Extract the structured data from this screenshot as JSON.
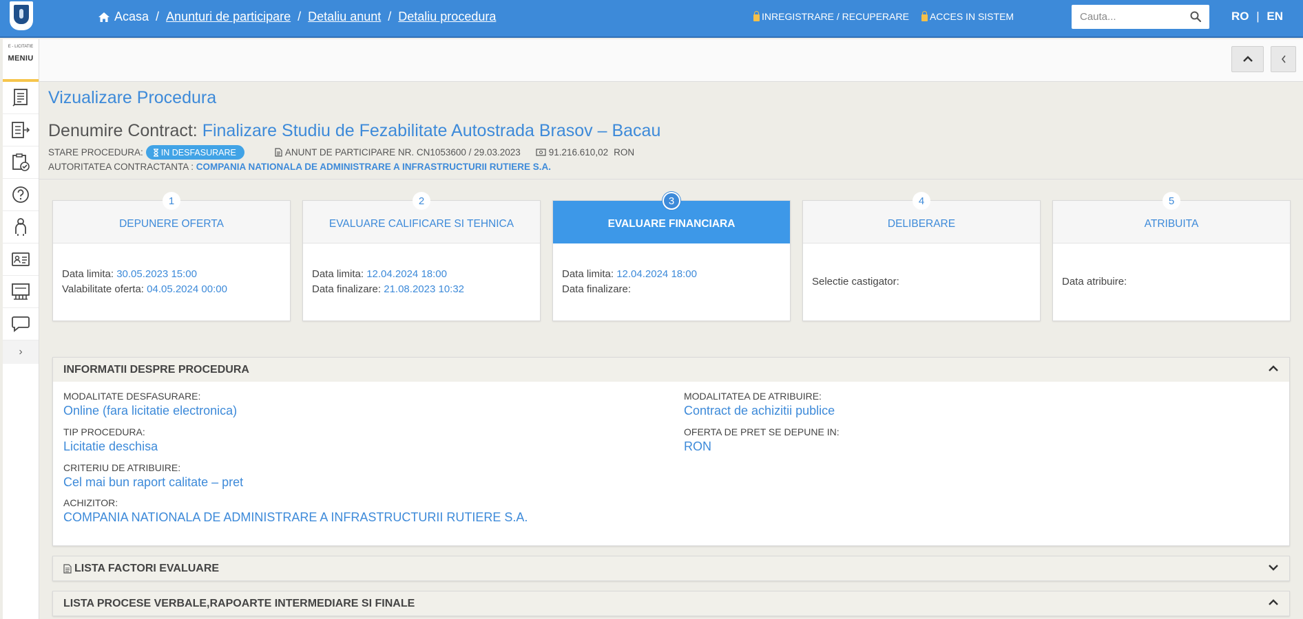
{
  "topbar": {
    "breadcrumbs": [
      "Acasa",
      "Anunturi de participare",
      "Detaliu anunt",
      "Detaliu procedura"
    ],
    "links": {
      "register": "INREGISTRARE / RECUPERARE",
      "login": "ACCES IN SISTEM"
    },
    "search_placeholder": "Cauta...",
    "lang": {
      "ro": "RO",
      "sep": "|",
      "en": "EN"
    }
  },
  "sidebar": {
    "brand_small": "E - LICITATIE",
    "menu_label": "MENIU",
    "items": [
      "document-icon",
      "list-arrow-icon",
      "clipboard-check-icon",
      "help-icon",
      "user-icon",
      "id-card-icon",
      "chart-icon",
      "chat-icon"
    ],
    "toggle": "›"
  },
  "header": {
    "title": "Vizualizare Procedura",
    "contract_label": "Denumire Contract:",
    "contract_name": "Finalizare Studiu de Fezabilitate Autostrada Brasov – Bacau",
    "status_label": "STARE PROCEDURA:",
    "status_value": "IN DESFASURARE",
    "notice": "ANUNT DE PARTICIPARE NR. CN1053600 / 29.03.2023",
    "value_amount": "91.216.610,02",
    "value_currency": "RON",
    "authority_label": "AUTORITATEA CONTRACTANTA :",
    "authority_value": "COMPANIA NATIONALA DE ADMINISTRARE A INFRASTRUCTURII RUTIERE S.A."
  },
  "steps": [
    {
      "num": "1",
      "title": "DEPUNERE OFERTA",
      "l1": "Data limita:",
      "v1": "30.05.2023 15:00",
      "l2": "Valabilitate oferta:",
      "v2": "04.05.2024 00:00"
    },
    {
      "num": "2",
      "title": "EVALUARE CALIFICARE SI TEHNICA",
      "l1": "Data limita:",
      "v1": "12.04.2024 18:00",
      "l2": "Data finalizare:",
      "v2": "21.08.2023 10:32"
    },
    {
      "num": "3",
      "title": "EVALUARE FINANCIARA",
      "l1": "Data limita:",
      "v1": "12.04.2024 18:00",
      "l2": "Data finalizare:",
      "v2": ""
    },
    {
      "num": "4",
      "title": "DELIBERARE",
      "l1": "Selectie castigator:"
    },
    {
      "num": "5",
      "title": "ATRIBUITA",
      "l1": "Data atribuire:"
    }
  ],
  "info_panel": {
    "title": "INFORMATII DESPRE PROCEDURA",
    "fields": {
      "mod_desf_label": "MODALITATE DESFASURARE:",
      "mod_desf_value": "Online (fara licitatie electronica)",
      "tip_label": "TIP PROCEDURA:",
      "tip_value": "Licitatie deschisa",
      "criteriu_label": "CRITERIU DE ATRIBUIRE:",
      "criteriu_value": "Cel mai bun raport calitate – pret",
      "achizitor_label": "ACHIZITOR:",
      "achizitor_value": "COMPANIA NATIONALA DE ADMINISTRARE A INFRASTRUCTURII RUTIERE S.A.",
      "mod_atr_label": "MODALITATEA DE ATRIBUIRE:",
      "mod_atr_value": "Contract de achizitii publice",
      "oferta_label": "OFERTA DE PRET SE DEPUNE IN:",
      "oferta_value": "RON"
    }
  },
  "factori_panel": {
    "title": "LISTA FACTORI EVALUARE"
  },
  "procese_panel": {
    "title": "LISTA PROCESE VERBALE,RAPOARTE INTERMEDIARE SI FINALE"
  },
  "colors": {
    "primary": "#3d8ad9",
    "badge": "#41a3e6",
    "accent": "#f6c54c",
    "background": "#eeede7"
  }
}
